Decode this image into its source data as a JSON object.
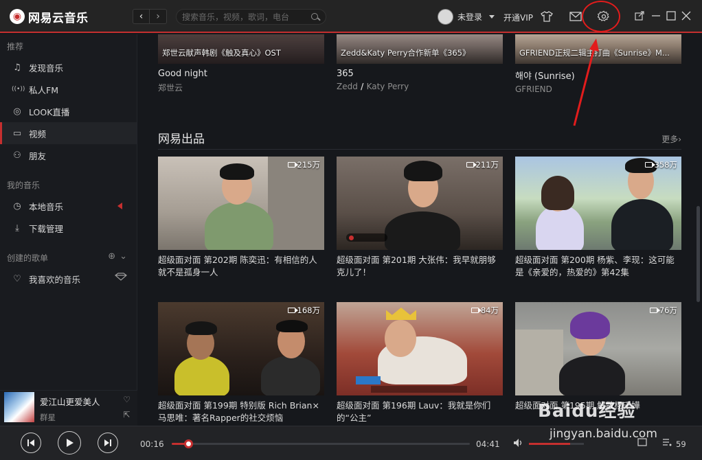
{
  "app": {
    "name": "网易云音乐",
    "logo_glyph": "◉"
  },
  "topbar": {
    "back_icon": "‹",
    "forward_icon": "›",
    "search_placeholder": "搜索音乐，视频，歌词，电台",
    "user_name": "未登录",
    "vip_label": "开通VIP"
  },
  "sidebar": {
    "section_recommend": "推荐",
    "items_recommend": [
      {
        "label": "发现音乐",
        "icon": "♫"
      },
      {
        "label": "私人FM",
        "icon": "((•))"
      },
      {
        "label": "LOOK直播",
        "icon": "◎"
      },
      {
        "label": "视频",
        "icon": "▭"
      },
      {
        "label": "朋友",
        "icon": "⚇"
      }
    ],
    "section_my_music": "我的音乐",
    "items_my_music": [
      {
        "label": "本地音乐",
        "icon": "◷"
      },
      {
        "label": "下载管理",
        "icon": "⤓"
      }
    ],
    "section_playlists": "创建的歌单",
    "items_playlists": [
      {
        "label": "我喜欢的音乐",
        "icon": "♡"
      }
    ]
  },
  "now_playing": {
    "title": "爱江山更爱美人",
    "artist": "群星"
  },
  "top_songs": [
    {
      "caption": "郑世云献声韩剧《触及真心》OST",
      "title": "Good night",
      "artist": "郑世云"
    },
    {
      "caption": "Zedd&Katy Perry合作新单《365》",
      "title": "365",
      "artist_a": "Zedd",
      "artist_sep": " / ",
      "artist_b": "Katy Perry"
    },
    {
      "caption": "GFRIEND正规二辑主打曲《Sunrise》M...",
      "title": "해야 (Sunrise)",
      "artist": "GFRIEND"
    }
  ],
  "section": {
    "title": "网易出品",
    "more": "更多›"
  },
  "videos": [
    {
      "views": "215万",
      "title": "超级面对面 第202期 陈奕迅：有相信的人 就不是孤身一人"
    },
    {
      "views": "211万",
      "title": "超级面对面 第201期 大张伟：我早就朋够克儿了！"
    },
    {
      "views": "358万",
      "title": "超级面对面 第200期  杨紫、李现：这可能是《亲爱的，热爱的》第42集"
    },
    {
      "views": "168万",
      "title": "超级面对面 第199期 特别版 Rich Brian×马思唯：著名Rapper的社交烦恼"
    },
    {
      "views": "84万",
      "title": "超级面对面 第196期 Lauv：我就是你们的“公主”"
    },
    {
      "views": "76万",
      "title": "超级面对面 第195期 解散杨千嬅"
    }
  ],
  "player": {
    "current_time": "00:16",
    "total_time": "04:41",
    "progress_fraction": 0.056,
    "volume_fraction": 0.75,
    "playlist_count": "59"
  },
  "watermark": {
    "text": "Baidu经验",
    "sub": "jingyan.baidu.com"
  },
  "colors": {
    "accent": "#c62f2f",
    "annotation": "#e21c1c"
  }
}
